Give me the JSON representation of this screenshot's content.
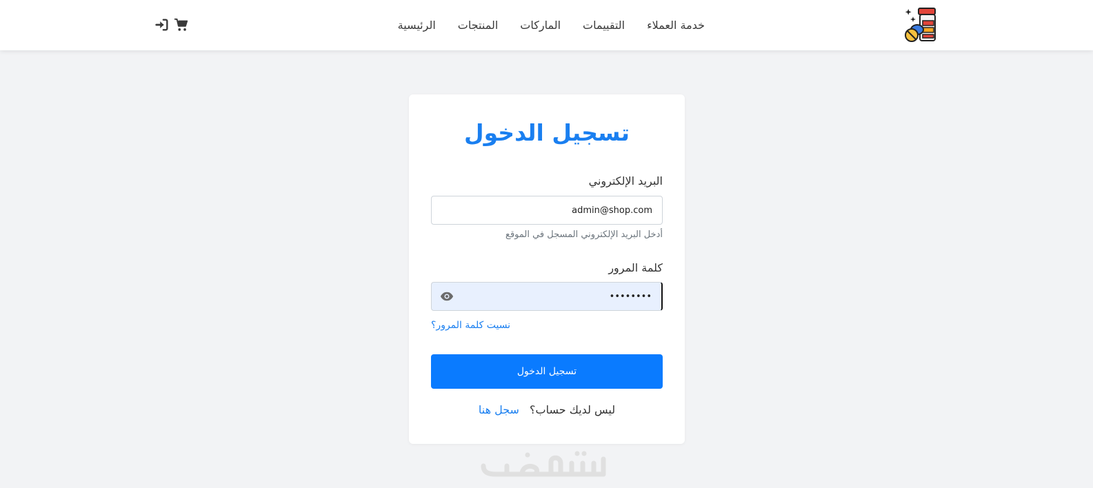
{
  "navbar": {
    "links": [
      {
        "label": "الرئيسية"
      },
      {
        "label": "المنتجات"
      },
      {
        "label": "الماركات"
      },
      {
        "label": "التقييمات"
      },
      {
        "label": "خدمة العملاء"
      }
    ],
    "icons": [
      "cart-icon",
      "login-icon"
    ]
  },
  "login": {
    "title": "تسجيل الدخول",
    "email_label": "البريد الإلكتروني",
    "email_value": "admin@shop.com",
    "email_help": "أدخل البريد الإلكتروني المسجل في الموقع",
    "password_label": "كلمة المرور",
    "password_value": "password",
    "forgot_link": "نسيت كلمة المرور؟",
    "submit_label": "تسجيل الدخول",
    "no_account_text": "ليس لديك حساب؟",
    "register_link": "سجل هنا"
  },
  "colors": {
    "accent": "#0a7bff",
    "link": "#1a7ff0",
    "background": "#f2f3f5",
    "autofill": "#e8f0fe"
  }
}
